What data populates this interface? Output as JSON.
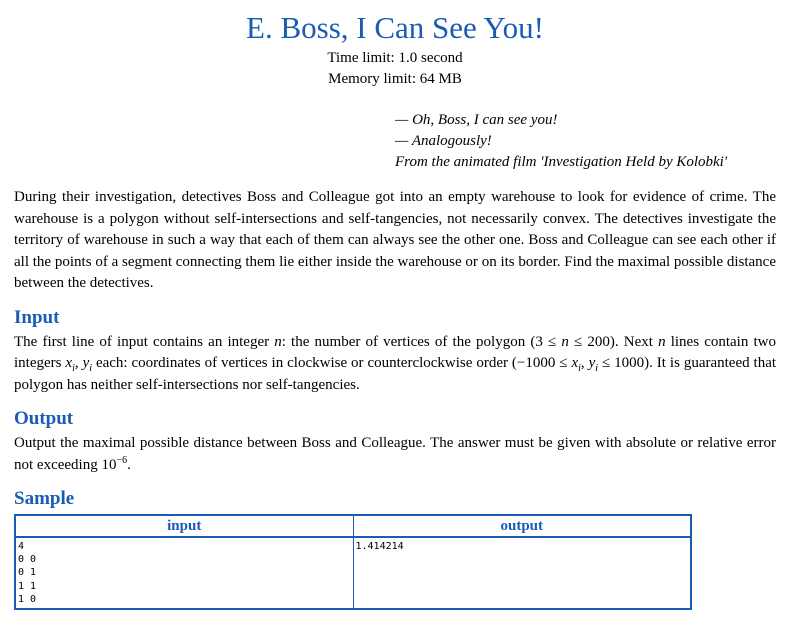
{
  "problem": {
    "title": "E. Boss, I Can See You!",
    "time_limit": "Time limit: 1.0 second",
    "memory_limit": "Memory limit: 64 MB"
  },
  "epigraph": {
    "line1": "— Oh, Boss, I can see you!",
    "line2": "— Analogously!",
    "line3": "From the animated film 'Investigation Held by Kolobki'"
  },
  "legend": {
    "text": "During their investigation, detectives Boss and Colleague got into an empty warehouse to look for evidence of crime. The warehouse is a polygon without self-intersections and self-tangencies, not necessarily convex. The detectives investigate the territory of warehouse in such a way that each of them can always see the other one. Boss and Colleague can see each other if all the points of a segment connecting them lie either inside the warehouse or on its border. Find the maximal possible distance between the detectives."
  },
  "input_section": {
    "heading": "Input",
    "p1": "The first line of input contains an integer ",
    "n1": "n",
    "p2": ": the number of vertices of the polygon (3 ≤ ",
    "n2": "n",
    "p3": " ≤ 200). Next ",
    "n3": "n",
    "p4": " lines contain two integers ",
    "x1": "x",
    "i1": "i",
    "comma": ", ",
    "y1": "y",
    "i2": "i",
    "p5": " each: coordinates of vertices in clockwise or counterclockwise order (−1000 ≤ ",
    "x2": "x",
    "i3": "i",
    "comma2": ", ",
    "y2": "y",
    "i4": "i",
    "p6": " ≤ 1000). It is guaranteed that polygon has neither self-intersections nor self-tangencies."
  },
  "output_section": {
    "heading": "Output",
    "p1": "Output the maximal possible distance between Boss and Colleague. The answer must be given with absolute or relative error not exceeding 10",
    "exp": "−6",
    "p2": "."
  },
  "sample": {
    "heading": "Sample",
    "col_input": "input",
    "col_output": "output",
    "input_text": "4\n0 0\n0 1\n1 1\n1 0",
    "output_text": "1.414214"
  },
  "colors": {
    "accent": "#1a5cb4"
  }
}
